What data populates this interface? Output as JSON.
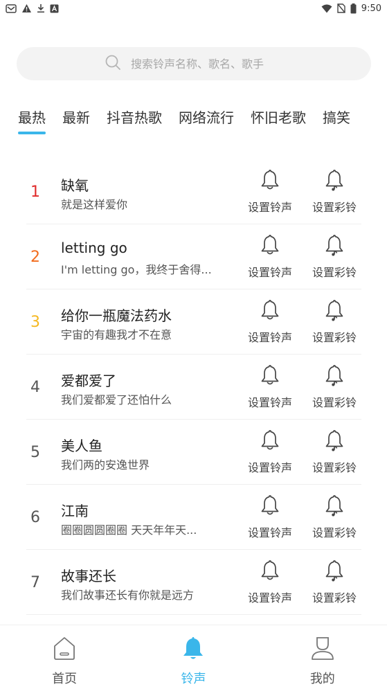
{
  "status_bar": {
    "time": "9:50",
    "icons": [
      "mail-icon",
      "warning-icon",
      "download-icon",
      "app-icon",
      "wifi-icon",
      "no-sim-icon",
      "battery-icon"
    ]
  },
  "search": {
    "placeholder": "搜索铃声名称、歌名、歌手"
  },
  "tabs": [
    {
      "label": "最热",
      "active": true
    },
    {
      "label": "最新"
    },
    {
      "label": "抖音热歌"
    },
    {
      "label": "网络流行"
    },
    {
      "label": "怀旧老歌"
    },
    {
      "label": "搞笑"
    }
  ],
  "actions": {
    "set_ringtone": "设置铃声",
    "set_crbt": "设置彩铃"
  },
  "songs": [
    {
      "rank": "1",
      "title": "缺氧",
      "subtitle": "就是这样爱你"
    },
    {
      "rank": "2",
      "title": "letting go",
      "subtitle": "I'm letting go，我终于舍得..."
    },
    {
      "rank": "3",
      "title": "给你一瓶魔法药水",
      "subtitle": "宇宙的有趣我才不在意"
    },
    {
      "rank": "4",
      "title": "爱都爱了",
      "subtitle": "我们爱都爱了还怕什么"
    },
    {
      "rank": "5",
      "title": "美人鱼",
      "subtitle": "我们两的安逸世界"
    },
    {
      "rank": "6",
      "title": "江南",
      "subtitle": "圈圈圆圆圈圈 天天年年天..."
    },
    {
      "rank": "7",
      "title": "故事还长",
      "subtitle": "我们故事还长有你就是远方"
    }
  ],
  "bottom_nav": [
    {
      "label": "首页"
    },
    {
      "label": "铃声",
      "active": true
    },
    {
      "label": "我的"
    }
  ],
  "colors": {
    "accent": "#3ab6ea",
    "rank1": "#e02b2b",
    "rank2": "#f26c1d",
    "rank3": "#f5b821"
  }
}
